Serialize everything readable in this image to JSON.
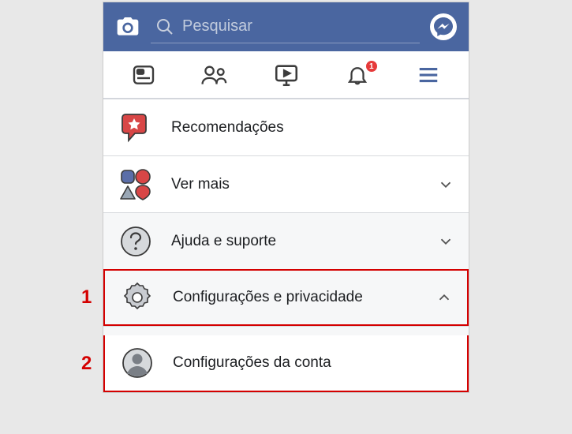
{
  "colors": {
    "brand": "#4a66a0",
    "badge": "#e63a3a",
    "annotation": "#d40000"
  },
  "search": {
    "placeholder": "Pesquisar"
  },
  "tabs": {
    "notification_count": "1"
  },
  "menu": {
    "items": [
      {
        "label": "Recomendações"
      },
      {
        "label": "Ver mais"
      },
      {
        "label": "Ajuda e suporte"
      },
      {
        "label": "Configurações e privacidade"
      },
      {
        "label": "Configurações da conta"
      }
    ]
  },
  "annotations": {
    "one": "1",
    "two": "2"
  }
}
